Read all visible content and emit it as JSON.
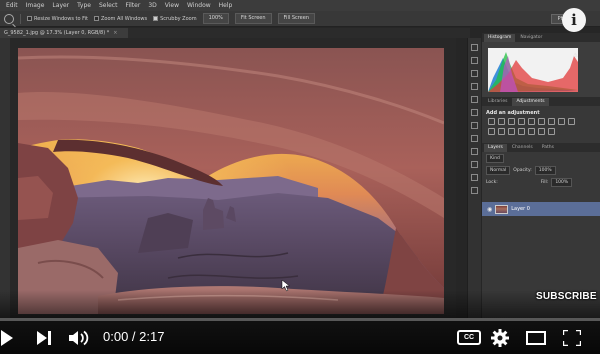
{
  "menubar": {
    "items": [
      "Edit",
      "Image",
      "Layer",
      "Type",
      "Select",
      "Filter",
      "3D",
      "View",
      "Window",
      "Help"
    ]
  },
  "options": {
    "resize_windows": "Resize Windows to Fit",
    "zoom_all_windows": "Zoom All Windows",
    "scrubby_zoom": "Scrubby Zoom",
    "zoom_100": "100%",
    "fit_screen": "Fit Screen",
    "fill_screen": "Fill Screen",
    "workspace": "Photog"
  },
  "document": {
    "tab_title": "G_9582_1.jpg @ 17.3% (Layer 0, RGB/8) *",
    "close": "×"
  },
  "panels": {
    "top_tabs": [
      "Histogram",
      "Navigator"
    ],
    "histogram_warning": "⚠",
    "mid_tabs": [
      "Libraries",
      "Adjustments"
    ],
    "adjustments_title": "Add an adjustment",
    "layer_tabs": [
      "Layers",
      "Channels",
      "Paths"
    ],
    "kind_label": "Kind",
    "blend_mode": "Normal",
    "opacity_label": "Opacity:",
    "opacity_value": "100%",
    "lock_label": "Lock:",
    "fill_label": "Fill:",
    "fill_value": "100%",
    "layer_name": "Layer 0"
  },
  "player": {
    "time": "0:00 / 2:17",
    "progress": 0,
    "cc_label": "CC",
    "subscribe": "SUBSCRIBE"
  },
  "colors": {
    "progress_red": "#ff0000",
    "layer_selected": "#5b6e98",
    "ps_background": "#262626"
  }
}
